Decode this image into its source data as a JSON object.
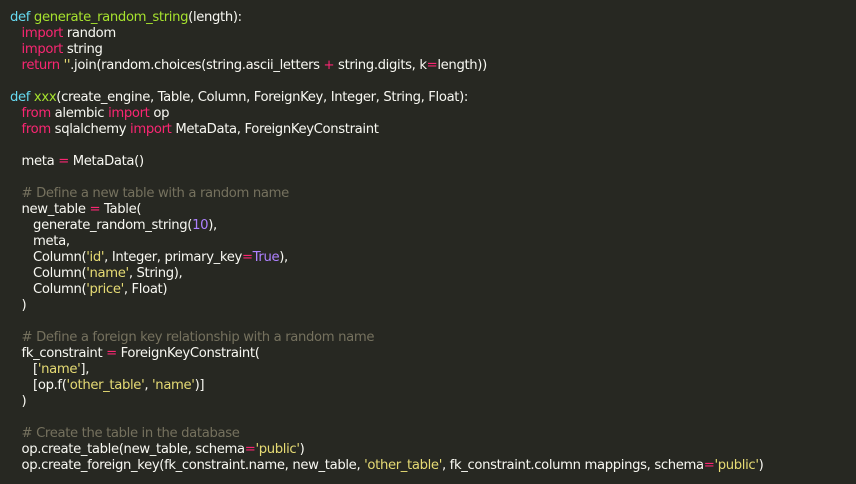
{
  "colors": {
    "background": "#272822",
    "plain": "#f8f8f2",
    "keyword": "#66d9ef",
    "import": "#f92672",
    "defname": "#a6e22e",
    "string": "#e6db74",
    "number": "#ae81ff",
    "const": "#ae81ff",
    "op": "#f92672",
    "comment": "#75715e"
  },
  "code": {
    "lines": [
      [
        [
          "keyword",
          "def"
        ],
        [
          "plain",
          " "
        ],
        [
          "defname",
          "generate_random_string"
        ],
        [
          "plain",
          "(length):"
        ]
      ],
      [
        [
          "plain",
          "   "
        ],
        [
          "import",
          "import"
        ],
        [
          "plain",
          " random"
        ]
      ],
      [
        [
          "plain",
          "   "
        ],
        [
          "import",
          "import"
        ],
        [
          "plain",
          " string"
        ]
      ],
      [
        [
          "plain",
          "   "
        ],
        [
          "import",
          "return"
        ],
        [
          "plain",
          " "
        ],
        [
          "string",
          "''"
        ],
        [
          "plain",
          ".join(random.choices(string.ascii_letters "
        ],
        [
          "op",
          "+"
        ],
        [
          "plain",
          " string.digits, k"
        ],
        [
          "op",
          "="
        ],
        [
          "plain",
          "length))"
        ]
      ],
      [],
      [
        [
          "keyword",
          "def"
        ],
        [
          "plain",
          " "
        ],
        [
          "defname",
          "xxx"
        ],
        [
          "plain",
          "(create_engine, Table, Column, ForeignKey, Integer, String, Float):"
        ]
      ],
      [
        [
          "plain",
          "   "
        ],
        [
          "import",
          "from"
        ],
        [
          "plain",
          " alembic "
        ],
        [
          "import",
          "import"
        ],
        [
          "plain",
          " op"
        ]
      ],
      [
        [
          "plain",
          "   "
        ],
        [
          "import",
          "from"
        ],
        [
          "plain",
          " sqlalchemy "
        ],
        [
          "import",
          "import"
        ],
        [
          "plain",
          " MetaData, ForeignKeyConstraint"
        ]
      ],
      [],
      [
        [
          "plain",
          "   meta "
        ],
        [
          "op",
          "="
        ],
        [
          "plain",
          " MetaData()"
        ]
      ],
      [],
      [
        [
          "plain",
          "   "
        ],
        [
          "comment",
          "# Define a new table with a random name"
        ]
      ],
      [
        [
          "plain",
          "   new_table "
        ],
        [
          "op",
          "="
        ],
        [
          "plain",
          " Table("
        ]
      ],
      [
        [
          "plain",
          "      generate_random_string("
        ],
        [
          "number",
          "10"
        ],
        [
          "plain",
          "),"
        ]
      ],
      [
        [
          "plain",
          "      meta,"
        ]
      ],
      [
        [
          "plain",
          "      Column("
        ],
        [
          "string",
          "'id'"
        ],
        [
          "plain",
          ", Integer, primary_key"
        ],
        [
          "op",
          "="
        ],
        [
          "const",
          "True"
        ],
        [
          "plain",
          "),"
        ]
      ],
      [
        [
          "plain",
          "      Column("
        ],
        [
          "string",
          "'name'"
        ],
        [
          "plain",
          ", String),"
        ]
      ],
      [
        [
          "plain",
          "      Column("
        ],
        [
          "string",
          "'price'"
        ],
        [
          "plain",
          ", Float)"
        ]
      ],
      [
        [
          "plain",
          "   )"
        ]
      ],
      [],
      [
        [
          "plain",
          "   "
        ],
        [
          "comment",
          "# Define a foreign key relationship with a random name"
        ]
      ],
      [
        [
          "plain",
          "   fk_constraint "
        ],
        [
          "op",
          "="
        ],
        [
          "plain",
          " ForeignKeyConstraint("
        ]
      ],
      [
        [
          "plain",
          "      ["
        ],
        [
          "string",
          "'name'"
        ],
        [
          "plain",
          "],"
        ]
      ],
      [
        [
          "plain",
          "      [op.f("
        ],
        [
          "string",
          "'other_table'"
        ],
        [
          "plain",
          ", "
        ],
        [
          "string",
          "'name'"
        ],
        [
          "plain",
          ")]"
        ]
      ],
      [
        [
          "plain",
          "   )"
        ]
      ],
      [],
      [
        [
          "plain",
          "   "
        ],
        [
          "comment",
          "# Create the table in the database"
        ]
      ],
      [
        [
          "plain",
          "   op.create_table(new_table, schema"
        ],
        [
          "op",
          "="
        ],
        [
          "string",
          "'public'"
        ],
        [
          "plain",
          ")"
        ]
      ],
      [
        [
          "plain",
          "   op.create_foreign_key(fk_constraint.name, new_table, "
        ],
        [
          "string",
          "'other_table'"
        ],
        [
          "plain",
          ", fk_constraint.column mappings, schema"
        ],
        [
          "op",
          "="
        ],
        [
          "string",
          "'public'"
        ],
        [
          "plain",
          ")"
        ]
      ]
    ]
  }
}
